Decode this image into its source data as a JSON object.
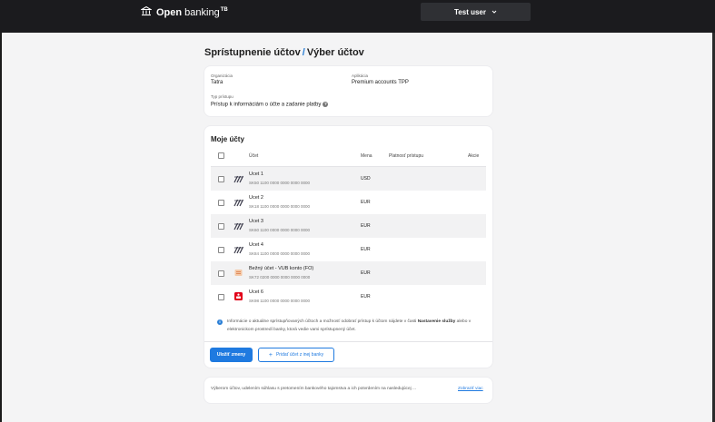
{
  "header": {
    "brand_name_bold": "Open",
    "brand_name_rest": " banking",
    "brand_tm": "TB",
    "user_button": "Test user"
  },
  "page": {
    "title_part1": "Sprístupnenie účtov",
    "title_sep": "/",
    "title_part2": "Výber účtov"
  },
  "details": {
    "org_label": "Organizácia",
    "org_value": "Tatra",
    "app_label": "Aplikácia",
    "app_value": "Premium accounts TPP",
    "access_label": "Typ prístupu",
    "access_value": "Prístup k informáciám o účte a zadanie platby",
    "help_glyph": "?"
  },
  "accounts": {
    "title": "Moje účty",
    "columns": {
      "account": "Účet",
      "currency": "Mena",
      "validity": "Platnosť prístupu",
      "actions": "Akcie"
    },
    "rows": [
      {
        "name": "Ucet 1",
        "iban": "SK50 1100 0000 0000 0000 0000",
        "currency": "USD",
        "icon": "tatra-bank-logo-icon"
      },
      {
        "name": "Ucet 2",
        "iban": "SK18 1100 0000 0000 0000 0000",
        "currency": "EUR",
        "icon": "tatra-bank-logo-icon"
      },
      {
        "name": "Ucet 3",
        "iban": "SK60 1100 0000 0000 0000 0000",
        "currency": "EUR",
        "icon": "tatra-bank-logo-icon"
      },
      {
        "name": "Ucet 4",
        "iban": "SK84 1100 0000 0000 0000 0000",
        "currency": "EUR",
        "icon": "tatra-bank-logo-icon"
      },
      {
        "name": "Bežný účet - VUB konto (FO)",
        "iban": "SK72 0200 0000 0000 0000 0000",
        "currency": "EUR",
        "icon": "vub-bank-logo-icon"
      },
      {
        "name": "Ucet 6",
        "iban": "SK98 1100 0000 0000 0000 0000",
        "currency": "EUR",
        "icon": "slsp-bank-logo-icon"
      }
    ],
    "info": {
      "glyph": "i",
      "text_before": "Informácie o aktuálne sprístupňovaných účtoch a možnosť odobrať prístup k účtom nájdete v časti ",
      "text_bold": "Nastavenie služby",
      "text_after": " alebo v elektronickom prostredí banky, ktorá vedie vami sprístupnený účet."
    },
    "save_button": "Uložiť zmeny",
    "add_button_plus": "+",
    "add_button": "Pridať účet z inej banky"
  },
  "consent": {
    "text": "Výberom účtov, udelením súhlasu s pretomením bankového tajomstva a ich potvrdením na nasledujúcej ...",
    "link": "Zobraziť viac"
  },
  "colors": {
    "accent": "#1f7ae0",
    "topbar": "#1b1b1e",
    "background": "#f4f4f5"
  }
}
